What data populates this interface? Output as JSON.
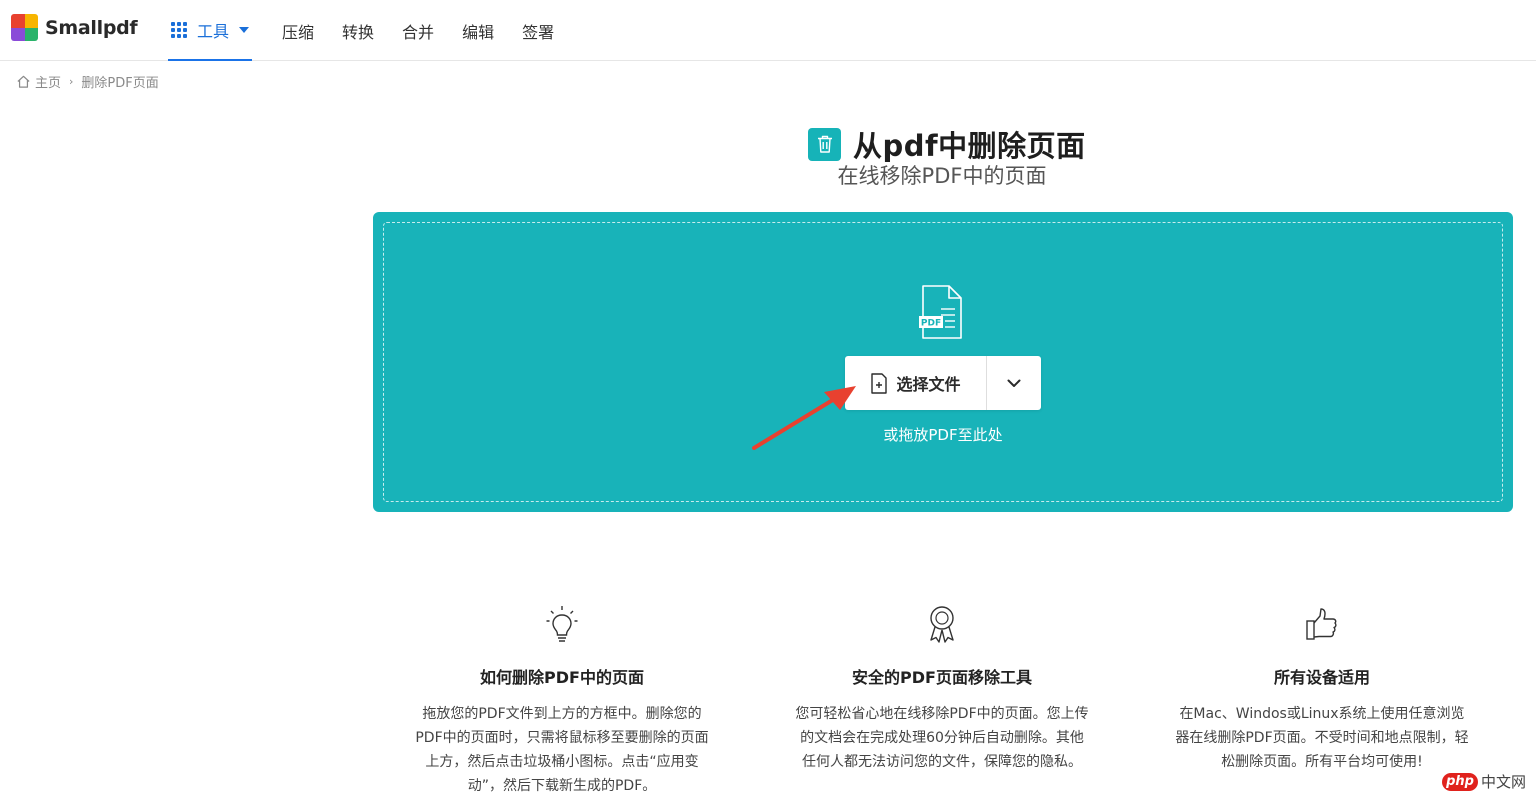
{
  "header": {
    "brand": "Smallpdf",
    "tools_label": "工具",
    "nav": [
      "压缩",
      "转换",
      "合并",
      "编辑",
      "签署"
    ]
  },
  "breadcrumb": {
    "home": "主页",
    "separator": "›",
    "current": "删除PDF页面"
  },
  "hero": {
    "title": "从pdf中删除页面",
    "subtitle": "在线移除PDF中的页面"
  },
  "dropzone": {
    "file_badge": "PDF",
    "select_label": "选择文件",
    "drop_hint": "或拖放PDF至此处",
    "color": "#18b3b9"
  },
  "features": [
    {
      "icon": "lightbulb-icon",
      "title": "如何删除PDF中的页面",
      "desc": "拖放您的PDF文件到上方的方框中。删除您的PDF中的页面时，只需将鼠标移至要删除的页面上方，然后点击垃圾桶小图标。点击“应用变动”，然后下载新生成的PDF。"
    },
    {
      "icon": "award-icon",
      "title": "安全的PDF页面移除工具",
      "desc": "您可轻松省心地在线移除PDF中的页面。您上传的文档会在完成处理60分钟后自动删除。其他任何人都无法访问您的文件，保障您的隐私。"
    },
    {
      "icon": "thumbs-up-icon",
      "title": "所有设备适用",
      "desc": "在Mac、Windos或Linux系统上使用任意浏览器在线删除PDF页面。不受时间和地点限制，轻松删除页面。所有平台均可使用!"
    }
  ],
  "watermark": {
    "badge": "php",
    "text": "中文网"
  },
  "colors": {
    "accent": "#1a6fd9",
    "teal": "#18b3b9",
    "arrow": "#e8412f"
  }
}
